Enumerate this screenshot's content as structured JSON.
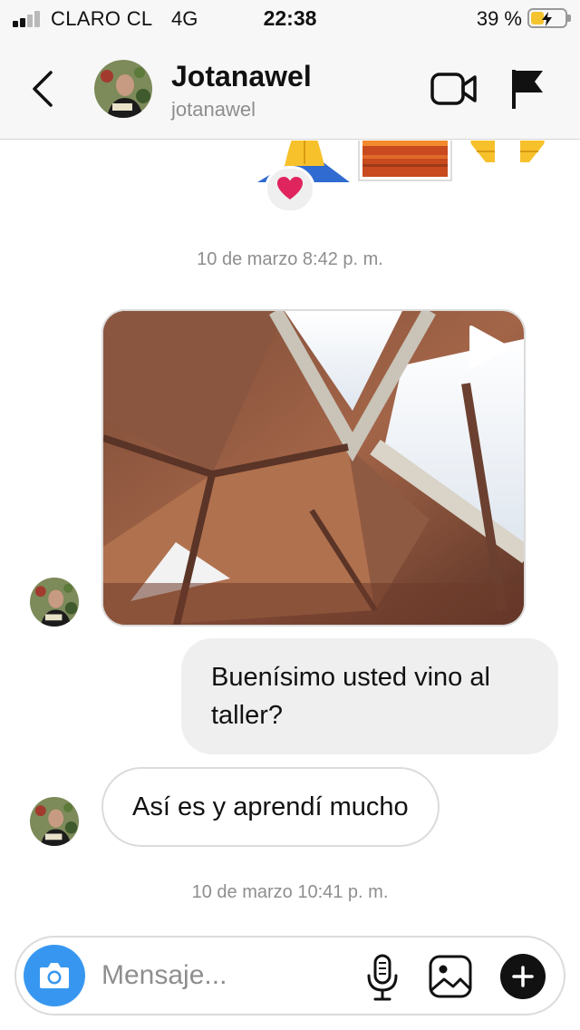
{
  "status_bar": {
    "carrier": "CLARO CL",
    "network": "4G",
    "time": "22:38",
    "battery_percent_label": "39 %",
    "battery_level": 0.39,
    "signal_bars_filled": 2,
    "signal_bars_total": 4
  },
  "header": {
    "name": "Jotanawel",
    "username": "jotanawel",
    "icons": {
      "back": "chevron-left-icon",
      "video": "video-camera-icon",
      "report": "flag-icon"
    }
  },
  "conversation": {
    "top_emojis": [
      "🙏",
      "🌅",
      "🙌"
    ],
    "reaction": "❤️",
    "timestamp_1": "10 de marzo 8:42 p. m.",
    "video_message": {
      "type": "video",
      "play_icon": "play-icon"
    },
    "outgoing_message": "Buenísimo usted vino al taller?",
    "incoming_message": "Así es y aprendí mucho",
    "timestamp_2": "10 de marzo 10:41 p. m."
  },
  "composer": {
    "placeholder": "Mensaje...",
    "icons": {
      "camera": "camera-icon",
      "mic": "microphone-icon",
      "gallery": "image-icon",
      "more": "plus-icon"
    }
  },
  "colors": {
    "accent": "#3797f0",
    "outgoing_bubble": "#efefef",
    "battery": "#f4c430",
    "reaction_heart": "#e0245e"
  }
}
